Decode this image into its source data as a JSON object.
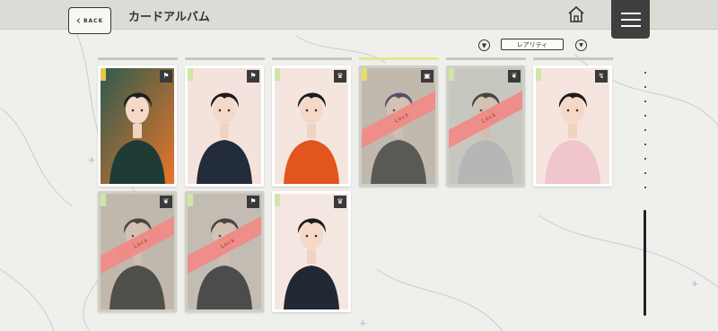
{
  "header": {
    "back_label": "BACK",
    "title": "カードアルバム",
    "home_icon": "home-icon",
    "menu_icon": "hamburger-menu-icon"
  },
  "filter": {
    "sort_icon": "sort-icon",
    "selected": "レアリティ",
    "dropdown_icon": "chevron-down-icon"
  },
  "cards": [
    {
      "locked": false,
      "type_icon": "flag-icon",
      "type_glyph": "⚑",
      "art_bg": "#2e5a4f",
      "art_bg2": "#e8762a",
      "outfit": "#1f3b36",
      "hair": "#1c1c1c",
      "accent": "#e6c94a"
    },
    {
      "locked": false,
      "type_icon": "flag-icon",
      "type_glyph": "⚑",
      "art_bg": "#f3e3dc",
      "art_bg2": "#f3e3dc",
      "outfit": "#222c3a",
      "hair": "#1c1c1c",
      "accent": "#cfe6a6"
    },
    {
      "locked": false,
      "type_icon": "crown-icon",
      "type_glyph": "♛",
      "art_bg": "#f4e6df",
      "art_bg2": "#f4e6df",
      "outfit": "#e2551e",
      "hair": "#1c1c1c",
      "accent": "#cfe6a6"
    },
    {
      "locked": true,
      "lock_label": "Lock",
      "type_icon": "gift-icon",
      "type_glyph": "▣",
      "art_bg": "#d9cdbf",
      "art_bg2": "#d9cdbf",
      "outfit": "#3a3a3a",
      "hair": "#2b2d55",
      "accent": "#e4de6a"
    },
    {
      "locked": true,
      "lock_label": "Lock",
      "type_icon": "leaf-icon",
      "type_glyph": "❦",
      "art_bg": "#e2e2dc",
      "art_bg2": "#e2e2dc",
      "outfit": "#c7c9cc",
      "hair": "#1c1c1c",
      "accent": "#cfe6a6"
    },
    {
      "locked": false,
      "type_icon": "bolt-icon",
      "type_glyph": "↯",
      "art_bg": "#f6e4df",
      "art_bg2": "#f6e4df",
      "outfit": "#f0c6cc",
      "hair": "#1c1c1c",
      "accent": "#cfe6a6"
    },
    {
      "locked": true,
      "lock_label": "Lock",
      "type_icon": "leaf-icon",
      "type_glyph": "❦",
      "art_bg": "#d8cbbd",
      "art_bg2": "#d8cbbd",
      "outfit": "#2a2a2a",
      "hair": "#1c1c1c",
      "accent": "#cfe6a6"
    },
    {
      "locked": true,
      "lock_label": "Lock",
      "type_icon": "flag-icon",
      "type_glyph": "⚑",
      "art_bg": "#dcd2c8",
      "art_bg2": "#dcd2c8",
      "outfit": "#26262e",
      "hair": "#1c1c1c",
      "accent": "#cfe6a6"
    },
    {
      "locked": false,
      "type_icon": "crown-icon",
      "type_glyph": "♛",
      "art_bg": "#f4e7e1",
      "art_bg2": "#f4e7e1",
      "outfit": "#222833",
      "hair": "#1c1c1c",
      "accent": "#cfe6a6"
    }
  ],
  "colors": {
    "lock_band": "#f28a86",
    "topbar": "#dcdcd6",
    "menu_bg": "#3f3f3f"
  }
}
